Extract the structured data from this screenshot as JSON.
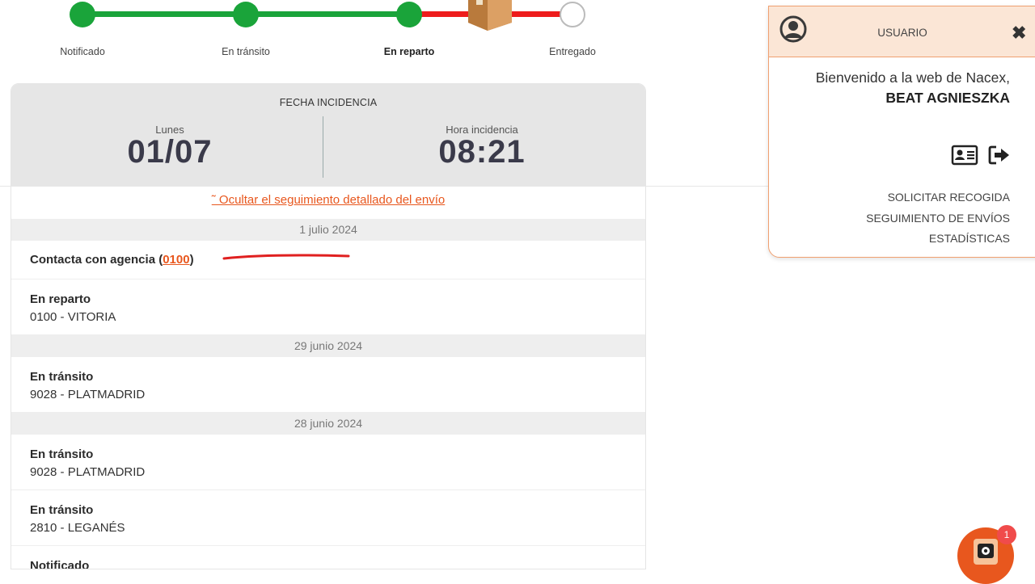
{
  "tracker": {
    "steps": [
      {
        "label": "Notificado",
        "state": "done"
      },
      {
        "label": "En tránsito",
        "state": "done"
      },
      {
        "label": "En reparto",
        "state": "active"
      },
      {
        "label": "Entregado",
        "state": "pending"
      }
    ],
    "colors": {
      "done": "#1aa43a",
      "remaining": "#ee1c1c"
    },
    "current_icon": "package-box-icon"
  },
  "incident": {
    "title": "FECHA INCIDENCIA",
    "day_label": "Lunes",
    "date": "01/07",
    "time_label": "Hora incidencia",
    "time": "08:21"
  },
  "toggle_link": "˜ Ocultar el seguimiento detallado del envío",
  "tracking": {
    "groups": [
      {
        "date": "1 julio 2024",
        "events": [
          {
            "title_prefix": "Contacta con agencia (",
            "link": "0100",
            "title_suffix": ")"
          },
          {
            "title": "En reparto",
            "detail": "0100 - VITORIA"
          }
        ]
      },
      {
        "date": "29 junio 2024",
        "events": [
          {
            "title": "En tránsito",
            "detail": "9028 - PLATMADRID"
          }
        ]
      },
      {
        "date": "28 junio 2024",
        "events": [
          {
            "title": "En tránsito",
            "detail": "9028 - PLATMADRID"
          },
          {
            "title": "En tránsito",
            "detail": "2810 - LEGANÉS"
          },
          {
            "title": "Notificado",
            "detail": ""
          }
        ]
      }
    ]
  },
  "user_popup": {
    "title": "USUARIO",
    "welcome": "Bienvenido a la web de Nacex,",
    "name": "BEAT AGNIESZKA",
    "icons": [
      "user-card-icon",
      "logout-icon"
    ],
    "menu": [
      "SOLICITAR RECOGIDA",
      "SEGUIMIENTO DE ENVÍOS",
      "ESTADÍSTICAS"
    ]
  },
  "chat": {
    "badge": "1",
    "accent": "#e8571e"
  }
}
